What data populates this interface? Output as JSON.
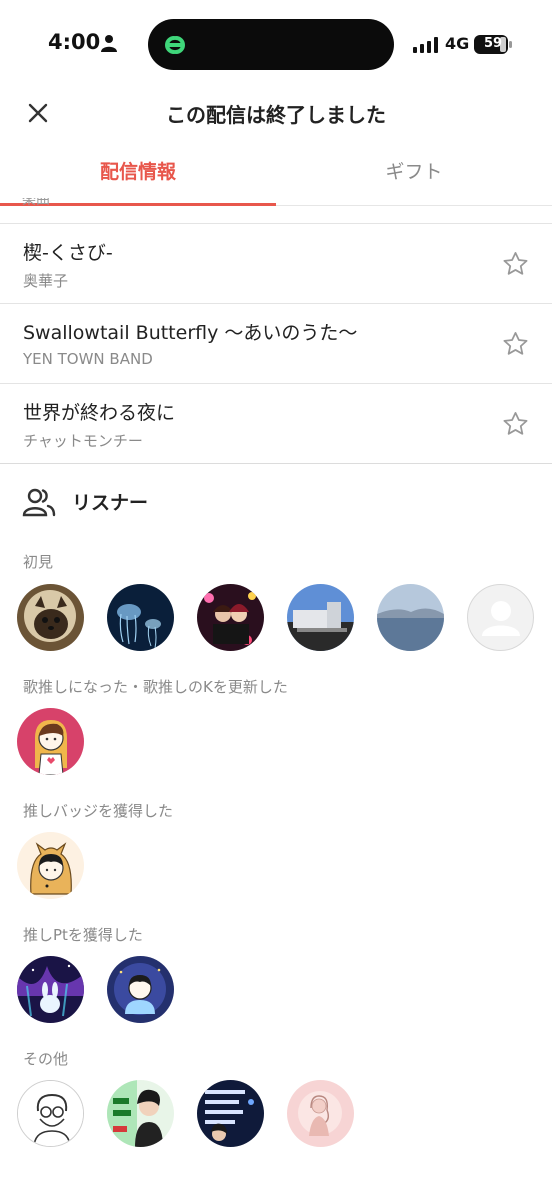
{
  "status_bar": {
    "time": "4:00",
    "network": "4G",
    "battery": "59"
  },
  "header": {
    "title": "この配信は終了しました"
  },
  "tabs": [
    {
      "label": "配信情報",
      "active": true
    },
    {
      "label": "ギフト",
      "active": false
    }
  ],
  "songs_heading_partial": "楽曲",
  "songs": [
    {
      "title": "楔-くさび-",
      "artist": "奥華子"
    },
    {
      "title": "Swallowtail Butterfly ～あいのうた～",
      "artist": "YEN TOWN BAND"
    },
    {
      "title": "世界が終わる夜に",
      "artist": "チャットモンチー"
    }
  ],
  "listeners": {
    "title": "リスナー",
    "sections": [
      {
        "label": "初見"
      },
      {
        "label": "歌推しになった・歌推しのKを更新した"
      },
      {
        "label": "推しバッジを獲得した"
      },
      {
        "label": "推しPtを獲得した"
      },
      {
        "label": "その他"
      }
    ]
  },
  "colors": {
    "accent": "#e8574c",
    "island_logo": "#3fd67a",
    "muted": "#8a8a8a"
  }
}
